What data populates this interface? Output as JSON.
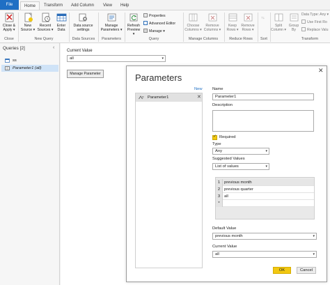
{
  "tabs": {
    "file": "File",
    "home": "Home",
    "transform": "Transform",
    "add_column": "Add Column",
    "view": "View",
    "help": "Help"
  },
  "ribbon": {
    "close_apply": [
      "Close &",
      "Apply ▾"
    ],
    "new_source": [
      "New",
      "Source ▾"
    ],
    "recent_sources": [
      "Recent",
      "Sources ▾"
    ],
    "enter_data": [
      "Enter",
      "Data"
    ],
    "data_source_settings": [
      "Data source",
      "settings"
    ],
    "manage_parameters": [
      "Manage",
      "Parameters ▾"
    ],
    "refresh_preview": [
      "Refresh",
      "Preview ▾"
    ],
    "properties": "Properties",
    "advanced_editor": "Advanced Editor",
    "manage": "Manage ▾",
    "choose_columns": [
      "Choose",
      "Columns ▾"
    ],
    "remove_columns": [
      "Remove",
      "Columns ▾"
    ],
    "keep_rows": [
      "Keep",
      "Rows ▾"
    ],
    "remove_rows": [
      "Remove",
      "Rows ▾"
    ],
    "split_column": [
      "Split",
      "Column ▾"
    ],
    "group_by": [
      "Group",
      "By"
    ],
    "data_type": "Data Type: Any ▾",
    "use_first_row": "Use First Ro",
    "replace_values": "Replace Valu",
    "groups": {
      "close": "Close",
      "new_query": "New Query",
      "data_sources": "Data Sources",
      "parameters": "Parameters",
      "query": "Query",
      "manage_columns": "Manage Columns",
      "reduce_rows": "Reduce Rows",
      "sort": "Sort",
      "transform": "Transform"
    }
  },
  "queries": {
    "header": "Queries [2]",
    "collapse": "‹",
    "items": [
      "ss",
      "Parameter1 (all)"
    ]
  },
  "main": {
    "current_value_label": "Current Value",
    "current_value": "all",
    "manage_button": "Manage Parameter"
  },
  "dialog": {
    "title": "Parameters",
    "close": "✕",
    "new_link": "New",
    "parameter_item": "Parameter1",
    "remove": "✕",
    "name_label": "Name",
    "name_value": "Parameter1",
    "description_label": "Description",
    "required_label": "Required",
    "required_checked": true,
    "type_label": "Type",
    "type_value": "Any",
    "suggested_label": "Suggested Values",
    "suggested_value": "List of values",
    "values": [
      {
        "num": "1",
        "text": "previous month"
      },
      {
        "num": "2",
        "text": "previous quarter"
      },
      {
        "num": "3",
        "text": "all"
      },
      {
        "num": "*",
        "text": ""
      }
    ],
    "default_label": "Default Value",
    "default_value": "previous month",
    "current_label": "Current Value",
    "current_value": "all",
    "ok": "OK",
    "cancel": "Cancel"
  },
  "colors": {
    "file_tab": "#1f6fc4",
    "accent_yellow": "#f2c811",
    "selected_query": "#cfe3f7"
  }
}
